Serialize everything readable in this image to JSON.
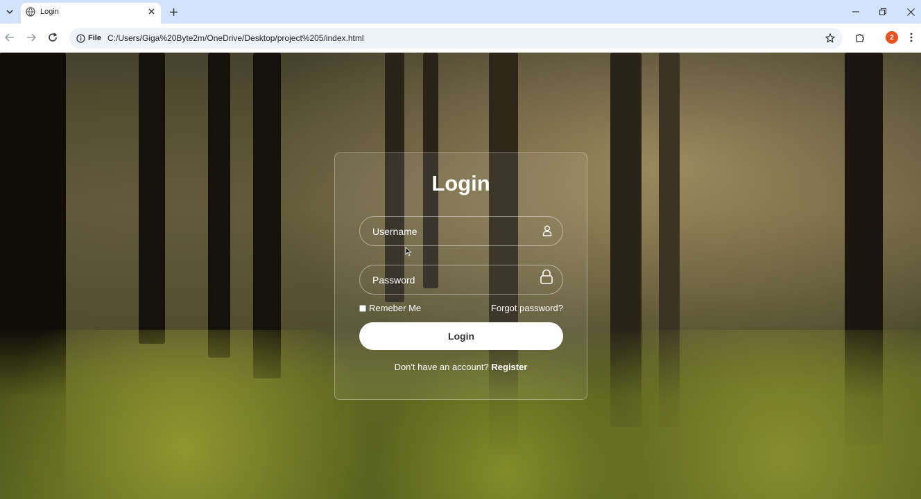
{
  "browser": {
    "tab_title": "Login",
    "site_label": "File",
    "url": "C:/Users/Giga%20Byte2m/OneDrive/Desktop/project%205/index.html",
    "profile_badge": "2",
    "accent": "#d3e3fd",
    "profile_color": "#e8541f"
  },
  "login": {
    "title": "Login",
    "username_placeholder": "Username",
    "password_placeholder": "Password",
    "remember_label": "Remeber Me",
    "forgot_label": "Forgot password?",
    "login_button": "Login",
    "register_prompt": "Don't have an account?",
    "register_link": "Register"
  },
  "icons": {
    "user": "user-icon",
    "lock": "lock-icon"
  }
}
